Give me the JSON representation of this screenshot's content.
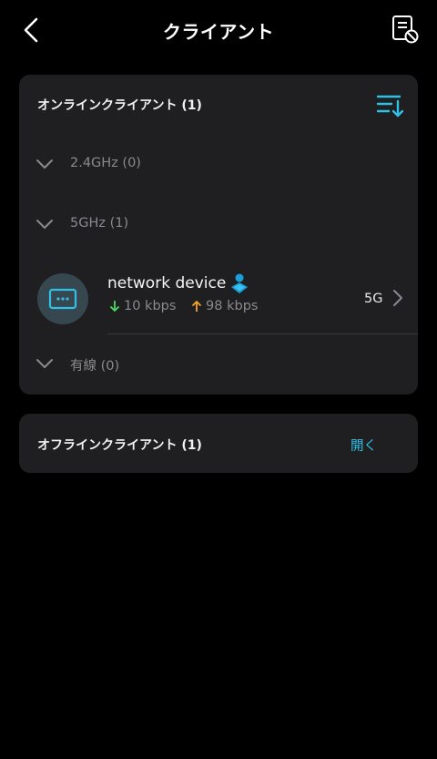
{
  "header": {
    "title": "クライアント",
    "back_icon": "chevron-left-icon",
    "blocked_icon": "blocked-list-icon"
  },
  "online": {
    "title": "オンラインクライアント (1)",
    "sort_icon": "sort-list-icon",
    "groups": [
      {
        "label": "2.4GHz (0)"
      },
      {
        "label": "5GHz (1)"
      },
      {
        "label": "有線 (0)"
      }
    ],
    "client": {
      "name": "network device",
      "icon": "device-icon",
      "badge_icon": "parental-control-person-icon",
      "download": "10 kbps",
      "upload": "98 kbps",
      "band": "5G"
    }
  },
  "offline": {
    "title": "オフラインクライアント (1)",
    "action": "開く"
  },
  "colors": {
    "accent": "#2fc2e6",
    "download_arrow": "#4cd964",
    "upload_arrow": "#f5a623",
    "card": "#1f1f21",
    "background": "#000000"
  }
}
